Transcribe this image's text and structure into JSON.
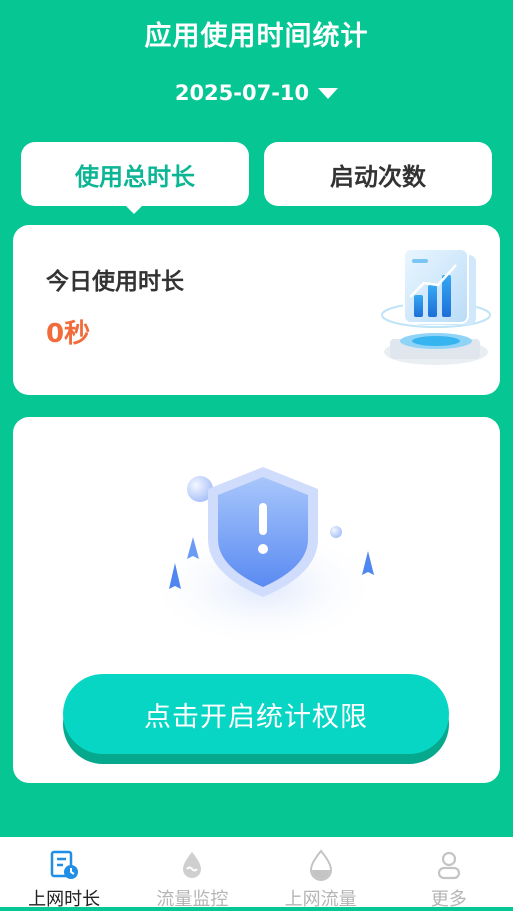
{
  "header": {
    "title": "应用使用时间统计",
    "date": "2025-07-10"
  },
  "tabs": [
    {
      "label": "使用总时长",
      "active": true
    },
    {
      "label": "启动次数",
      "active": false
    }
  ],
  "today_card": {
    "label": "今日使用时长",
    "value": "0秒"
  },
  "permission_card": {
    "button_label": "点击开启统计权限"
  },
  "bottom_nav": [
    {
      "label": "上网时长",
      "icon": "report-clock-icon",
      "active": true
    },
    {
      "label": "流量监控",
      "icon": "water-drop-icon",
      "active": false
    },
    {
      "label": "上网流量",
      "icon": "water-level-icon",
      "active": false
    },
    {
      "label": "更多",
      "icon": "user-icon",
      "active": false
    }
  ],
  "colors": {
    "background": "#06c693",
    "accent": "#0cb594",
    "value": "#f26b3a",
    "button": "#08d6c4"
  }
}
